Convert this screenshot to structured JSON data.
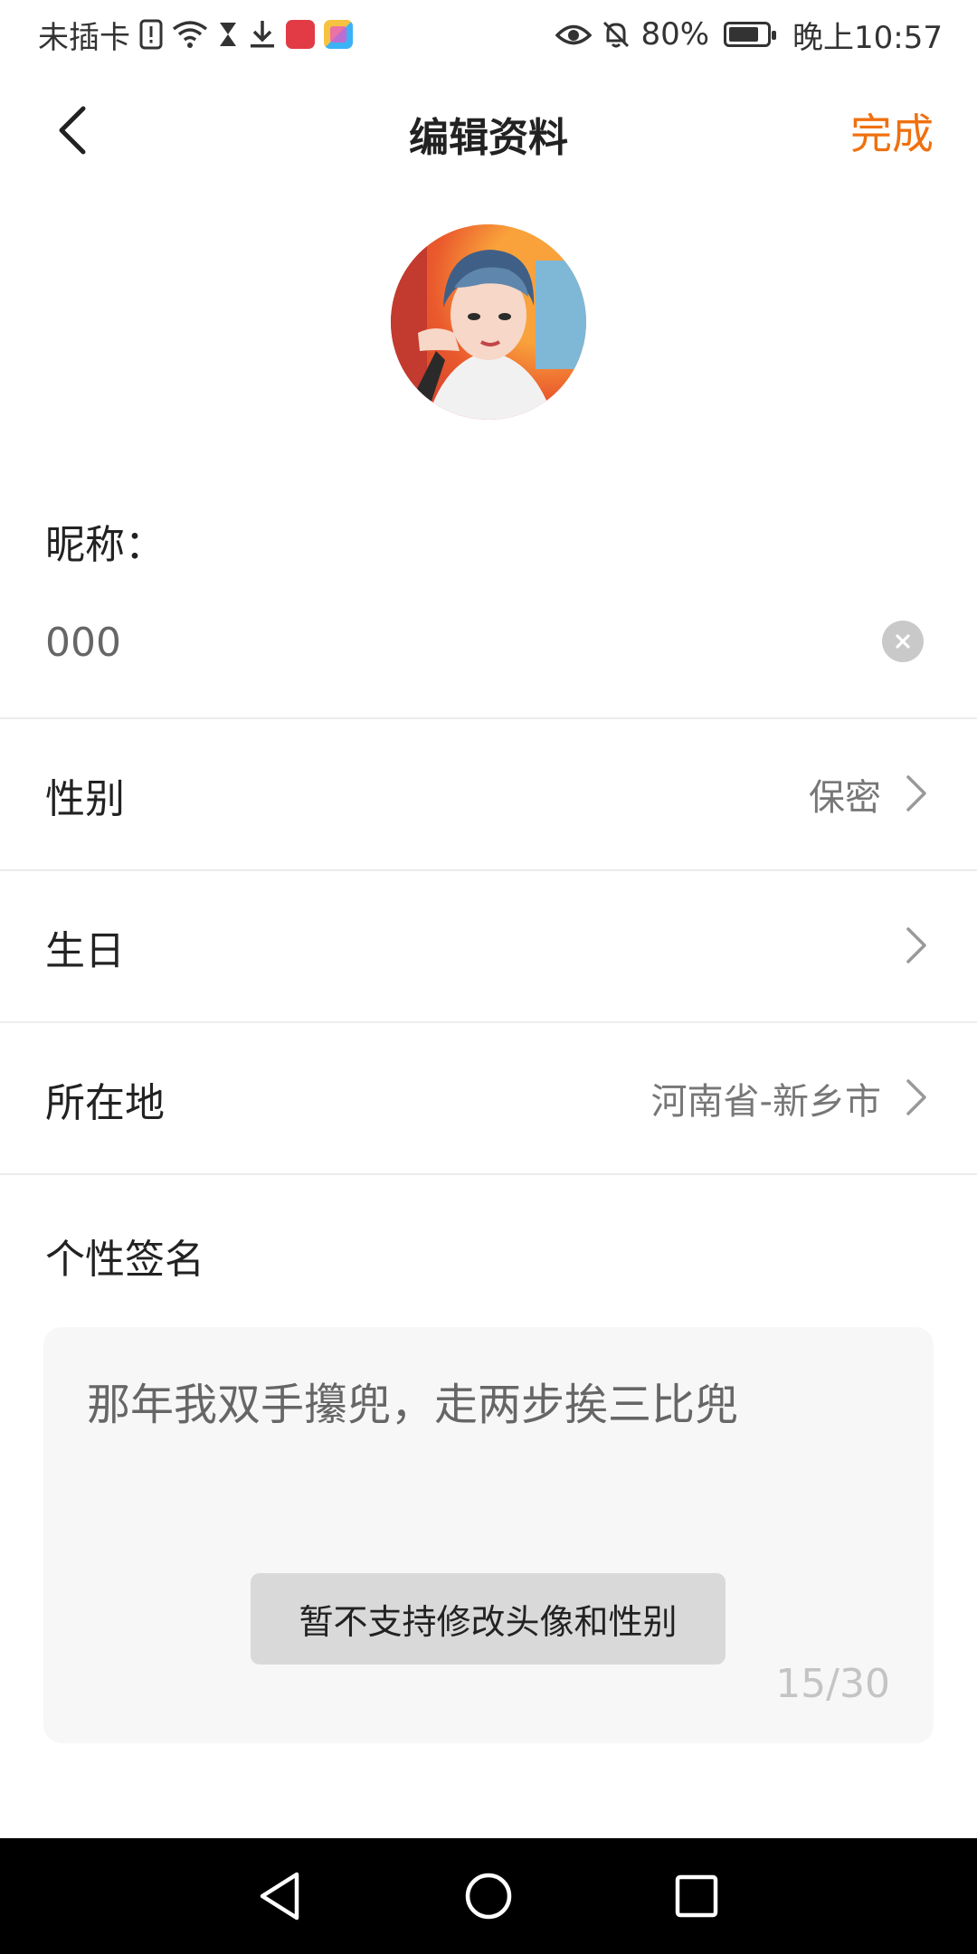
{
  "status_bar": {
    "carrier": "未插卡",
    "battery": "80%",
    "battery_level": 0.8,
    "time": "晚上10:57",
    "left_icons": [
      "sim-alert-icon",
      "wifi-icon",
      "hourglass-icon",
      "download-icon",
      "red-app-icon",
      "colorful-app-icon"
    ],
    "right_icons": [
      "eye-icon",
      "bell-off-icon",
      "battery-icon"
    ]
  },
  "header": {
    "title": "编辑资料",
    "done_label": "完成",
    "accent_color": "#f0700f"
  },
  "form": {
    "nickname_label": "昵称：",
    "nickname_value": "000",
    "gender_label": "性别",
    "gender_value": "保密",
    "birthday_label": "生日",
    "birthday_value": "",
    "location_label": "所在地",
    "location_value": "河南省-新乡市",
    "signature_label": "个性签名",
    "signature_value": "那年我双手攥兜，走两步挨三比兜",
    "signature_count": "15/30"
  },
  "toast": {
    "message": "暂不支持修改头像和性别"
  }
}
